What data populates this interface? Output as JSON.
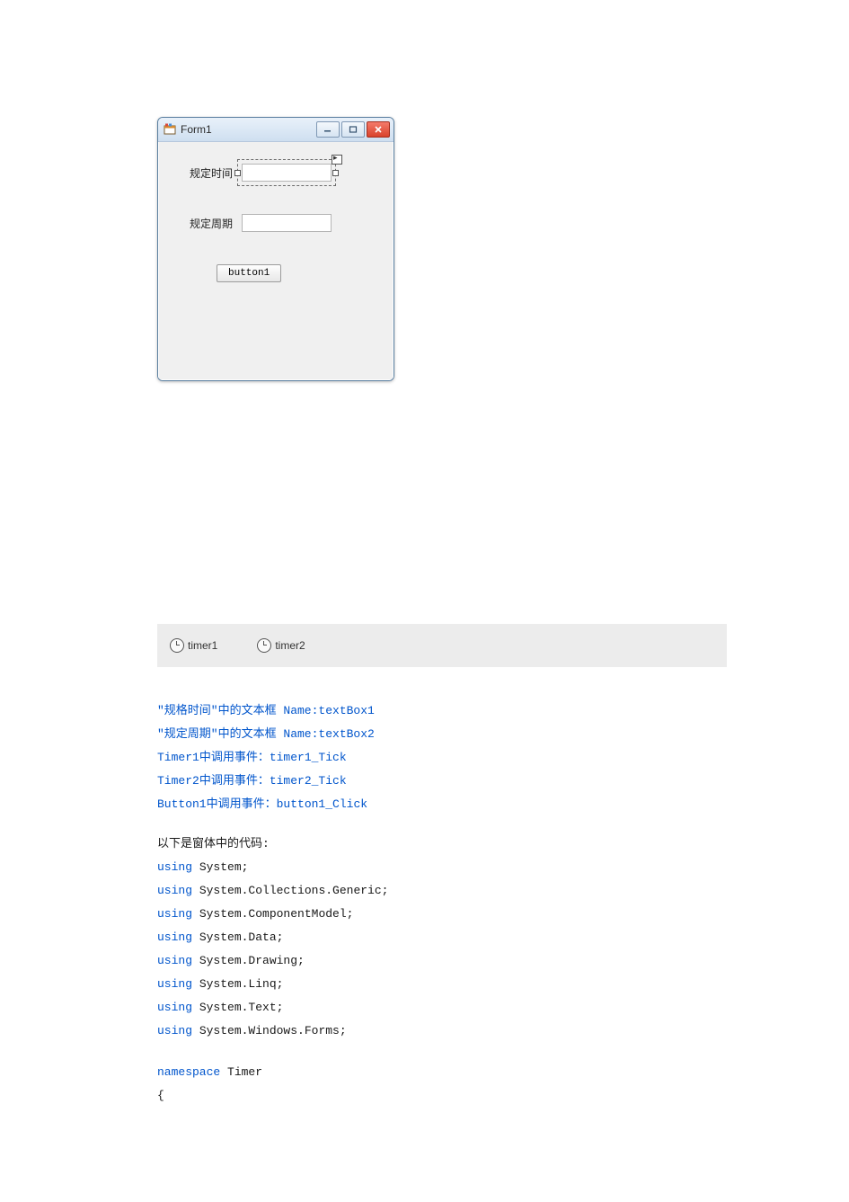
{
  "form": {
    "title": "Form1",
    "label_time": "规定时间",
    "label_period": "规定周期",
    "button_label": "button1",
    "textbox1_value": "",
    "textbox2_value": ""
  },
  "tray": {
    "timer1": "timer1",
    "timer2": "timer2"
  },
  "notes": {
    "line1_a": "\"规格时间\"中的文本框 ",
    "line1_b": "Name:textBox1",
    "line2_a": "\"规定周期\"中的文本框 ",
    "line2_b": "Name:textBox2",
    "line3_a": "Timer1",
    "line3_b": "中调用事件：",
    "line3_c": "timer1_Tick",
    "line4_a": "Timer2",
    "line4_b": "中调用事件：",
    "line4_c": "timer2_Tick",
    "line5_a": "Button1",
    "line5_b": "中调用事件：",
    "line5_c": "button1_Click",
    "code_heading": "以下是窗体中的代码:"
  },
  "code": {
    "kw": "using",
    "u1": " System;",
    "u2": " System.Collections.Generic;",
    "u3": " System.ComponentModel;",
    "u4": " System.Data;",
    "u5": " System.Drawing;",
    "u6": " System.Linq;",
    "u7": " System.Text;",
    "u8": " System.Windows.Forms;",
    "ns_kw": "namespace",
    "ns_name": " Timer",
    "brace": "{"
  }
}
